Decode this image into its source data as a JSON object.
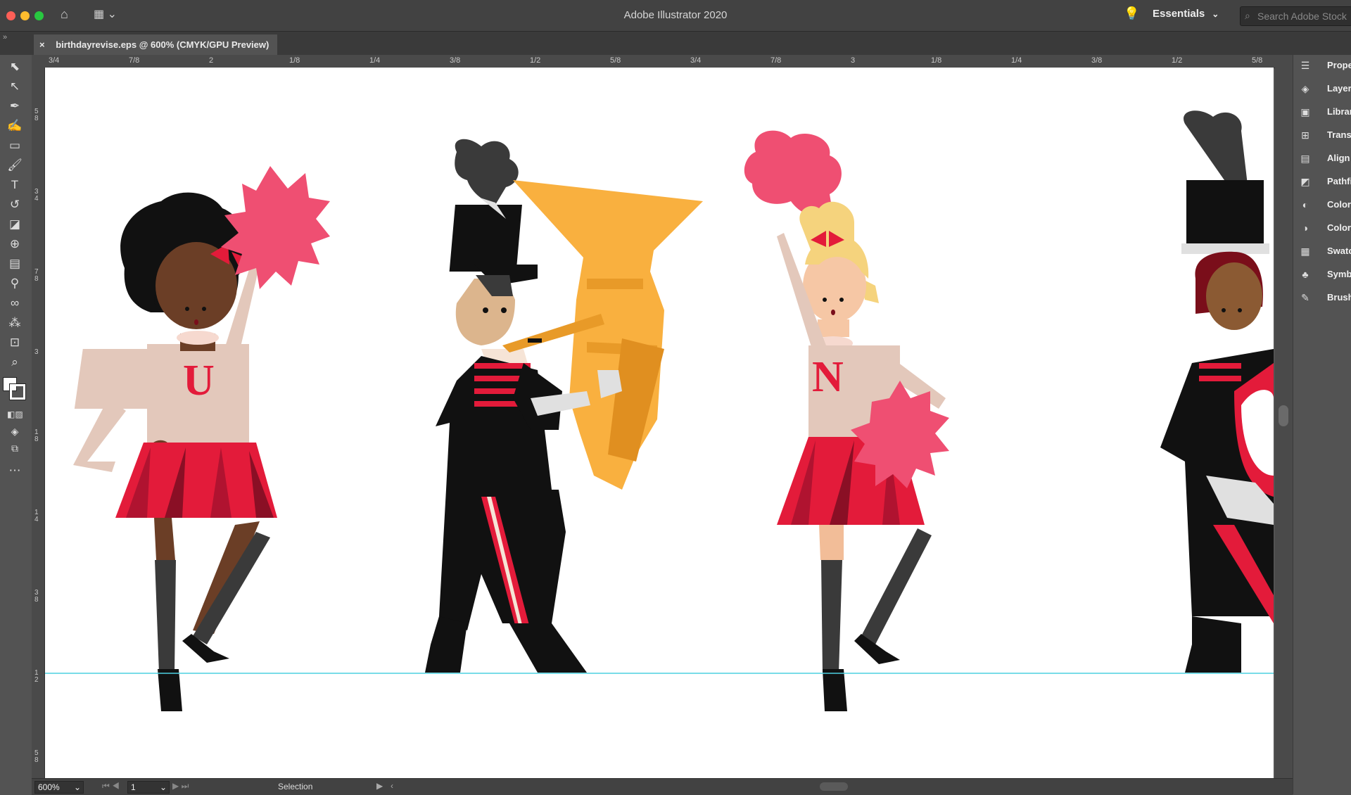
{
  "app": {
    "title": "Adobe Illustrator 2020",
    "workspace": "Essentials",
    "search_placeholder": "Search Adobe Stock"
  },
  "document_tab": {
    "close_glyph": "×",
    "label": "birthdayrevise.eps @ 600% (CMYK/GPU Preview)"
  },
  "ruler_h": [
    "3/4",
    "7/8",
    "2",
    "1/8",
    "1/4",
    "3/8",
    "1/2",
    "5/8",
    "3/4",
    "7/8",
    "3",
    "1/8",
    "1/4",
    "3/8",
    "1/2",
    "5/8"
  ],
  "ruler_v": [
    "5\n8",
    "3\n4",
    "7\n8",
    "3",
    "1\n8",
    "1\n4",
    "3\n8",
    "1\n2",
    "5\n8"
  ],
  "panels": [
    {
      "icon": "properties-icon",
      "label": "Propert"
    },
    {
      "icon": "layers-icon",
      "label": "Layers"
    },
    {
      "icon": "libraries-icon",
      "label": "Librarie"
    },
    {
      "icon": "transform-icon",
      "label": "Transfo"
    },
    {
      "icon": "align-icon",
      "label": "Align"
    },
    {
      "icon": "pathfinder-icon",
      "label": "Pathfin"
    },
    {
      "icon": "color-icon",
      "label": "Color"
    },
    {
      "icon": "color-guide-icon",
      "label": "Color G"
    },
    {
      "icon": "swatches-icon",
      "label": "Swatch"
    },
    {
      "icon": "symbols-icon",
      "label": "Symbol"
    },
    {
      "icon": "brushes-icon",
      "label": "Brushe"
    }
  ],
  "artwork": {
    "letters": [
      "U",
      "N"
    ]
  },
  "status": {
    "zoom": "600%",
    "artboard": "1",
    "tool": "Selection"
  },
  "colors": {
    "ui_dark": "#535353",
    "titlebar": "#424242",
    "cheer_red": "#e31b3a",
    "pompom": "#ef4f72",
    "tuba": "#f9b03f",
    "guide": "#4dd0e1"
  }
}
